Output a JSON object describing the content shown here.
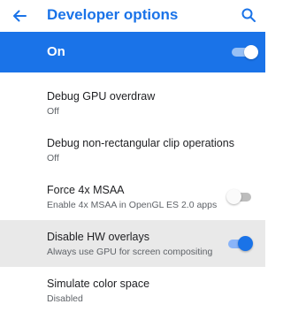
{
  "header": {
    "title": "Developer options",
    "back_icon": "arrow-back-icon",
    "search_icon": "search-icon"
  },
  "master": {
    "label": "On",
    "state": "on"
  },
  "items": [
    {
      "title": "Debug GPU overdraw",
      "subtitle": "Off"
    },
    {
      "title": "Debug non-rectangular clip operations",
      "subtitle": "Off"
    },
    {
      "title": "Force 4x MSAA",
      "subtitle": "Enable 4x MSAA in OpenGL ES 2.0 apps",
      "toggle": "off"
    },
    {
      "title": "Disable HW overlays",
      "subtitle": "Always use GPU for screen compositing",
      "toggle": "on",
      "highlighted": true
    },
    {
      "title": "Simulate color space",
      "subtitle": "Disabled"
    }
  ],
  "colors": {
    "accent": "#1a73e8",
    "highlight_row": "#e9e9e9"
  }
}
